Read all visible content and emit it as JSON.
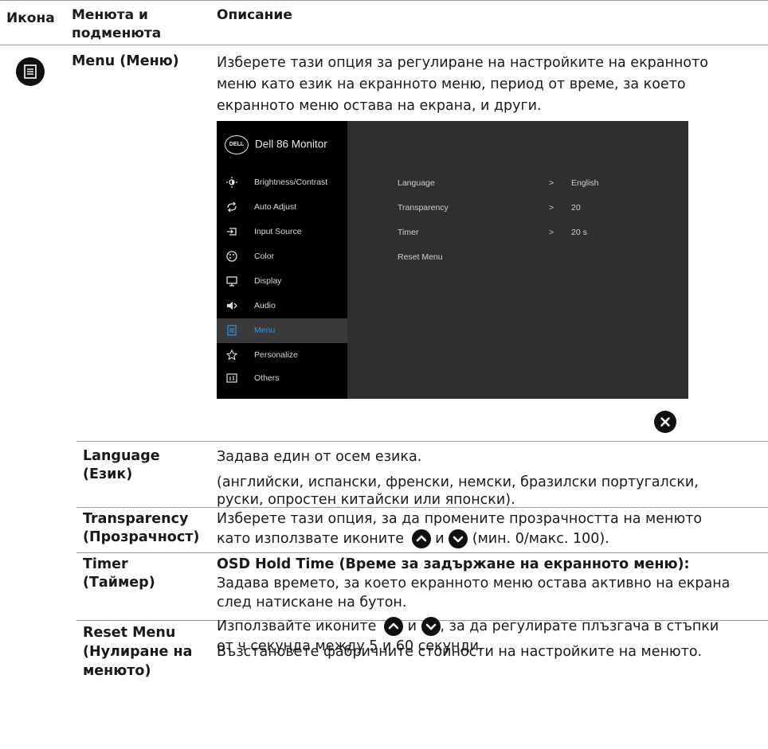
{
  "header": {
    "col_icon": "Икона",
    "col_menu_line1": "Менюта и",
    "col_menu_line2": "подменюта",
    "col_desc": "Описание"
  },
  "menu_row": {
    "icon": "list-menu-icon",
    "title": "Menu (Меню)",
    "desc_lines": [
      "Изберете тази опция за регулиране на настройките на екранното",
      "меню като език на екранното меню, период от време, за което",
      "екранното меню остава на екрана, и други."
    ]
  },
  "osd": {
    "title": "Dell 86 Monitor",
    "logo_text": "DELL",
    "items": [
      {
        "label": "Brightness/Contrast",
        "icon": "brightness-icon"
      },
      {
        "label": "Auto Adjust",
        "icon": "auto-adjust-icon"
      },
      {
        "label": "Input Source",
        "icon": "input-source-icon"
      },
      {
        "label": "Color",
        "icon": "color-icon"
      },
      {
        "label": "Display",
        "icon": "display-icon"
      },
      {
        "label": "Audio",
        "icon": "audio-icon"
      },
      {
        "label": "Menu",
        "icon": "menu-icon"
      },
      {
        "label": "Personalize",
        "icon": "star-icon"
      },
      {
        "label": "Others",
        "icon": "others-icon"
      }
    ],
    "active_item": "Menu",
    "settings": [
      {
        "label": "Language",
        "value": "English"
      },
      {
        "label": "Transparency",
        "value": "20"
      },
      {
        "label": "Timer",
        "value": "20 s"
      },
      {
        "label": "Reset Menu",
        "value": ""
      }
    ],
    "chevron": ">",
    "close_icon": "close-icon"
  },
  "rows": {
    "language": {
      "title1": "Language",
      "title2": "(Език)",
      "line1": "Задава един от осем езика.",
      "line2": "(английски, испански, френски, немски, бразилски португалски,",
      "line3": "руски, опростен китайски или японски)."
    },
    "transparency": {
      "title1": "Transparency",
      "title2": "(Прозрачност)",
      "line1": "Изберете тази опция, за да промените прозрачността на менюто",
      "line2a": "като използвате иконите",
      "line2b": "и",
      "line2c": "(мин. 0/макс. 100)."
    },
    "timer": {
      "title1": "Timer",
      "title2": "(Таймер)",
      "heading": "OSD Hold Time (Време за задържане на екранното меню):",
      "line1": "Задава времето, за което екранното меню остава активно на екрана",
      "line2": "след натискане на бутон.",
      "line3a": "Използвайте иконите",
      "line3b": "и",
      "line3c": ", за да регулирате плъзгача в стъпки",
      "line4": "от ч секунда между 5 и 60 секунди."
    },
    "reset": {
      "title1": "Reset Menu",
      "title2": "(Нулиране на",
      "title3": "менюто)",
      "desc": "Възстановете фабричните стойности на настройките на менюто."
    }
  },
  "icons": {
    "up": "up-arrow-icon",
    "down": "down-arrow-icon"
  }
}
